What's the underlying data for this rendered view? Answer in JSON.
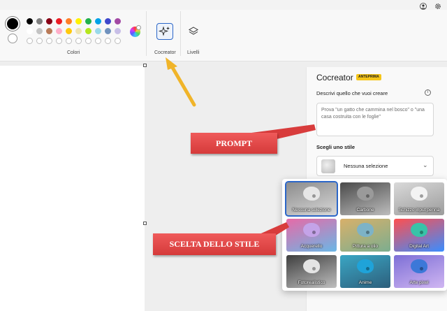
{
  "ribbon": {
    "colors_label": "Colori",
    "cocreator_label": "Cocreator",
    "layers_label": "Livelli",
    "primary_color": "#000000",
    "secondary_color": "#ffffff",
    "palette_rows": [
      [
        "#000000",
        "#7f7f7f",
        "#880015",
        "#ed1c24",
        "#ff7f27",
        "#fff200",
        "#22b14c",
        "#00a2e8",
        "#3f48cc",
        "#a349a4"
      ],
      [
        "#ffffff",
        "#c3c3c3",
        "#b97a57",
        "#ffaec9",
        "#ffc90e",
        "#efe4b0",
        "#b5e61d",
        "#99d9ea",
        "#7092be",
        "#c8bfe7"
      ],
      [
        "",
        "",
        "",
        "",
        "",
        "",
        "",
        "",
        "",
        ""
      ]
    ]
  },
  "cocreator_panel": {
    "title": "Cocreator",
    "preview_badge": "ANTEPRIMA",
    "describe_label": "Descrivi quello che vuoi creare",
    "prompt_placeholder": "Prova \"un gatto che cammina nel bosco\" o \"una casa costruita con le foglie\"",
    "choose_style_label": "Scegli uno stile",
    "selected_style": "Nessuna selezione"
  },
  "styles": [
    {
      "label": "Nessuna selezione",
      "selected": true,
      "bg": "linear-gradient(160deg,#8c8c8c,#d8d8d8)",
      "palette": "#e6e6e6"
    },
    {
      "label": "Carbone",
      "selected": false,
      "bg": "linear-gradient(160deg,#4a4a4a,#bdbdbd)",
      "palette": "#9a9a9a"
    },
    {
      "label": "Schizzo input penna",
      "selected": false,
      "bg": "linear-gradient(160deg,#d9d9d9,#9c9c9c)",
      "palette": "#f3f3f3"
    },
    {
      "label": "Acquerello",
      "selected": false,
      "bg": "linear-gradient(160deg,#e76aa7,#6ab7e6)",
      "palette": "#c4a3e8"
    },
    {
      "label": "Pittura a olio",
      "selected": false,
      "bg": "linear-gradient(160deg,#d8b06a,#7cae8f)",
      "palette": "#7db3c7"
    },
    {
      "label": "Digital Art",
      "selected": false,
      "bg": "linear-gradient(160deg,#ff4f4f,#3a8dff)",
      "palette": "#38c3a8"
    },
    {
      "label": "Fotorealistico",
      "selected": false,
      "bg": "linear-gradient(160deg,#3e3e3e,#bfbfbf)",
      "palette": "#e4e4e4"
    },
    {
      "label": "Anime",
      "selected": false,
      "bg": "linear-gradient(160deg,#3aa6c4,#2d5f7c)",
      "palette": "#1fa3d9"
    },
    {
      "label": "Arte pixel",
      "selected": false,
      "bg": "linear-gradient(160deg,#7d6fd6,#d0b6f2)",
      "palette": "#3c78d8"
    }
  ],
  "annotations": {
    "prompt_callout": "PROMPT",
    "style_callout": "SCELTA DELLO STILE",
    "callout_color": "#e04545",
    "arrow_color": "#f0b429"
  }
}
